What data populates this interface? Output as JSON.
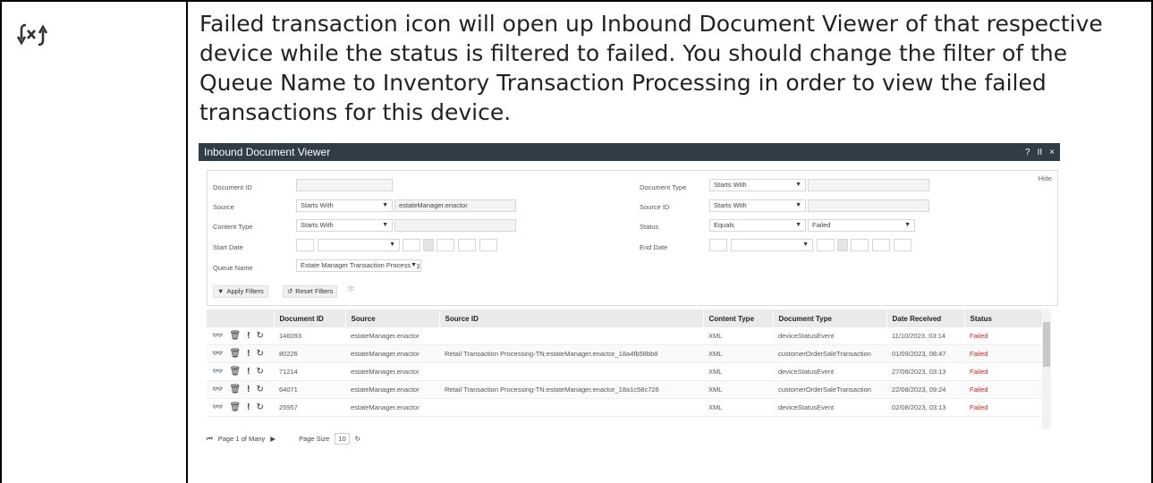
{
  "description": "Failed transaction icon will open up Inbound Document Viewer of that respective device while the status is filtered to failed. You should change the filter of the Queue Name to Inventory Transaction Processing in order to view the failed transactions for this device.",
  "icon": "failed-transaction-icon",
  "viewer": {
    "title": "Inbound Document Viewer",
    "controls": {
      "help": "?",
      "pause": "II",
      "close": "×"
    },
    "hide_label": "Hide",
    "filters": {
      "document_id": {
        "label": "Document ID",
        "value": ""
      },
      "source": {
        "label": "Source",
        "op": "Starts With",
        "value": "estateManager.enactor"
      },
      "content_type": {
        "label": "Content Type",
        "op": "Starts With",
        "value": ""
      },
      "start_date": {
        "label": "Start Date"
      },
      "queue_name": {
        "label": "Queue Name",
        "value": "Estate Manager Transaction Processing"
      },
      "document_type": {
        "label": "Document Type",
        "op": "Starts With",
        "value": ""
      },
      "source_id": {
        "label": "Source ID",
        "op": "Starts With",
        "value": ""
      },
      "status": {
        "label": "Status",
        "op": "Equals",
        "value": "Failed"
      },
      "end_date": {
        "label": "End Date"
      }
    },
    "apply_label": "Apply Filters",
    "reset_label": "Reset Filters",
    "columns": [
      "Document ID",
      "Source",
      "Source ID",
      "Content Type",
      "Document Type",
      "Date Received",
      "Status"
    ],
    "rows": [
      [
        "146093",
        "estateManager.enactor",
        "",
        "XML",
        "deviceStatusEvent",
        "11/10/2023, 03:14",
        "Failed"
      ],
      [
        "80226",
        "estateManager.enactor",
        "Retail Transaction Processing-TN:estateManager.enactor_18a4fb58bb8",
        "XML",
        "customerOrderSaleTransaction",
        "01/09/2023, 08:47",
        "Failed"
      ],
      [
        "71214",
        "estateManager.enactor",
        "",
        "XML",
        "deviceStatusEvent",
        "27/08/2023, 03:13",
        "Failed"
      ],
      [
        "64071",
        "estateManager.enactor",
        "Retail Transaction Processing-TN:estateManager.enactor_18a1c58c726",
        "XML",
        "customerOrderSaleTransaction",
        "22/08/2023, 09:24",
        "Failed"
      ],
      [
        "25957",
        "estateManager.enactor",
        "",
        "XML",
        "deviceStatusEvent",
        "02/08/2023, 03:13",
        "Failed"
      ]
    ],
    "pager": {
      "page_text": "Page 1 of Many",
      "size_label": "Page Size",
      "size_value": "10"
    }
  }
}
